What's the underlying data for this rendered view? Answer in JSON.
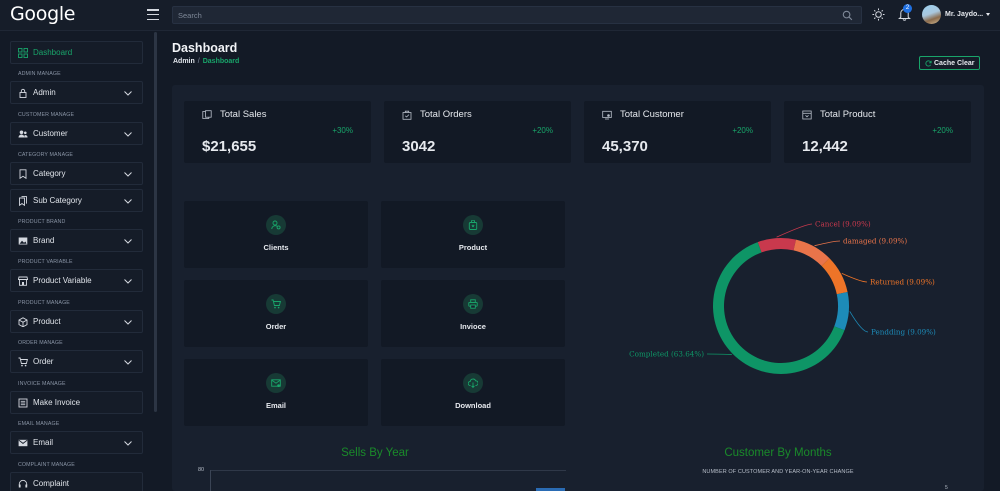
{
  "header": {
    "logo": "Google",
    "search_placeholder": "Search",
    "notification_count": "2",
    "username": "Mr. Jaydo..."
  },
  "sidebar": {
    "dashboard": "Dashboard",
    "sections": {
      "admin": "ADMIN MANAGE",
      "customer": "CUSTOMER MANAGE",
      "category": "CATEGORY MANAGE",
      "brand": "PRODUCT BRAND",
      "variable": "PRODUCT VARIABLE",
      "product": "PRODUCT MANAGE",
      "order": "ORDER MANAGE",
      "invoice": "INVOICE MANAGE",
      "email": "EMAIL MANAGE",
      "complaint": "COMPLAINT MANAGE"
    },
    "items": {
      "admin": "Admin",
      "customer": "Customer",
      "category": "Category",
      "sub_category": "Sub Category",
      "brand": "Brand",
      "product_variable": "Product Variable",
      "product": "Product",
      "order": "Order",
      "make_invoice": "Make Invoice",
      "email": "Email",
      "complaint": "Complaint"
    }
  },
  "main": {
    "title": "Dashboard",
    "breadcrumb": {
      "root": "Admin",
      "sep": "/",
      "current": "Dashboard"
    },
    "cache_button": "Cache Clear"
  },
  "stats": [
    {
      "title": "Total Sales",
      "change": "+30%",
      "value": "$21,655",
      "icon": "sales-icon"
    },
    {
      "title": "Total Orders",
      "change": "+20%",
      "value": "3042",
      "icon": "orders-icon"
    },
    {
      "title": "Total Customer",
      "change": "+20%",
      "value": "45,370",
      "icon": "customer-icon"
    },
    {
      "title": "Total Product",
      "change": "+20%",
      "value": "12,442",
      "icon": "product-icon"
    }
  ],
  "quick_actions": [
    {
      "label": "Clients",
      "icon": "clients-icon"
    },
    {
      "label": "Product",
      "icon": "product-bag-icon"
    },
    {
      "label": "Order",
      "icon": "cart-icon"
    },
    {
      "label": "Invioce",
      "icon": "printer-icon"
    },
    {
      "label": "Email",
      "icon": "email-icon"
    },
    {
      "label": "Download",
      "icon": "download-icon"
    }
  ],
  "chart_data": [
    {
      "type": "pie",
      "variant": "donut",
      "slices": [
        {
          "label": "Cancel (9.09%)",
          "value": 9.09,
          "color": "#c9394d"
        },
        {
          "label": "damaged (9.09%)",
          "value": 9.09,
          "color": "#e9744a"
        },
        {
          "label": "Returned (9.09%)",
          "value": 9.09,
          "color": "#ee7428"
        },
        {
          "label": "Pendding (9.09%)",
          "value": 9.09,
          "color": "#1d8bb8"
        },
        {
          "label": "Completed (63.64%)",
          "value": 63.64,
          "color": "#0e9566"
        }
      ]
    },
    {
      "type": "bar",
      "title": "Sells By Year",
      "ytick_top": "80",
      "series": []
    },
    {
      "type": "bar",
      "title": "Customer By Months",
      "subtitle": "NUMBER OF CUSTOMER AND YEAR-ON-YEAR CHANGE",
      "tick_peek": "5",
      "series": []
    }
  ],
  "colors": {
    "accent": "#19a56a",
    "background": "#131a26",
    "panel": "#18202e",
    "card": "#121925"
  }
}
